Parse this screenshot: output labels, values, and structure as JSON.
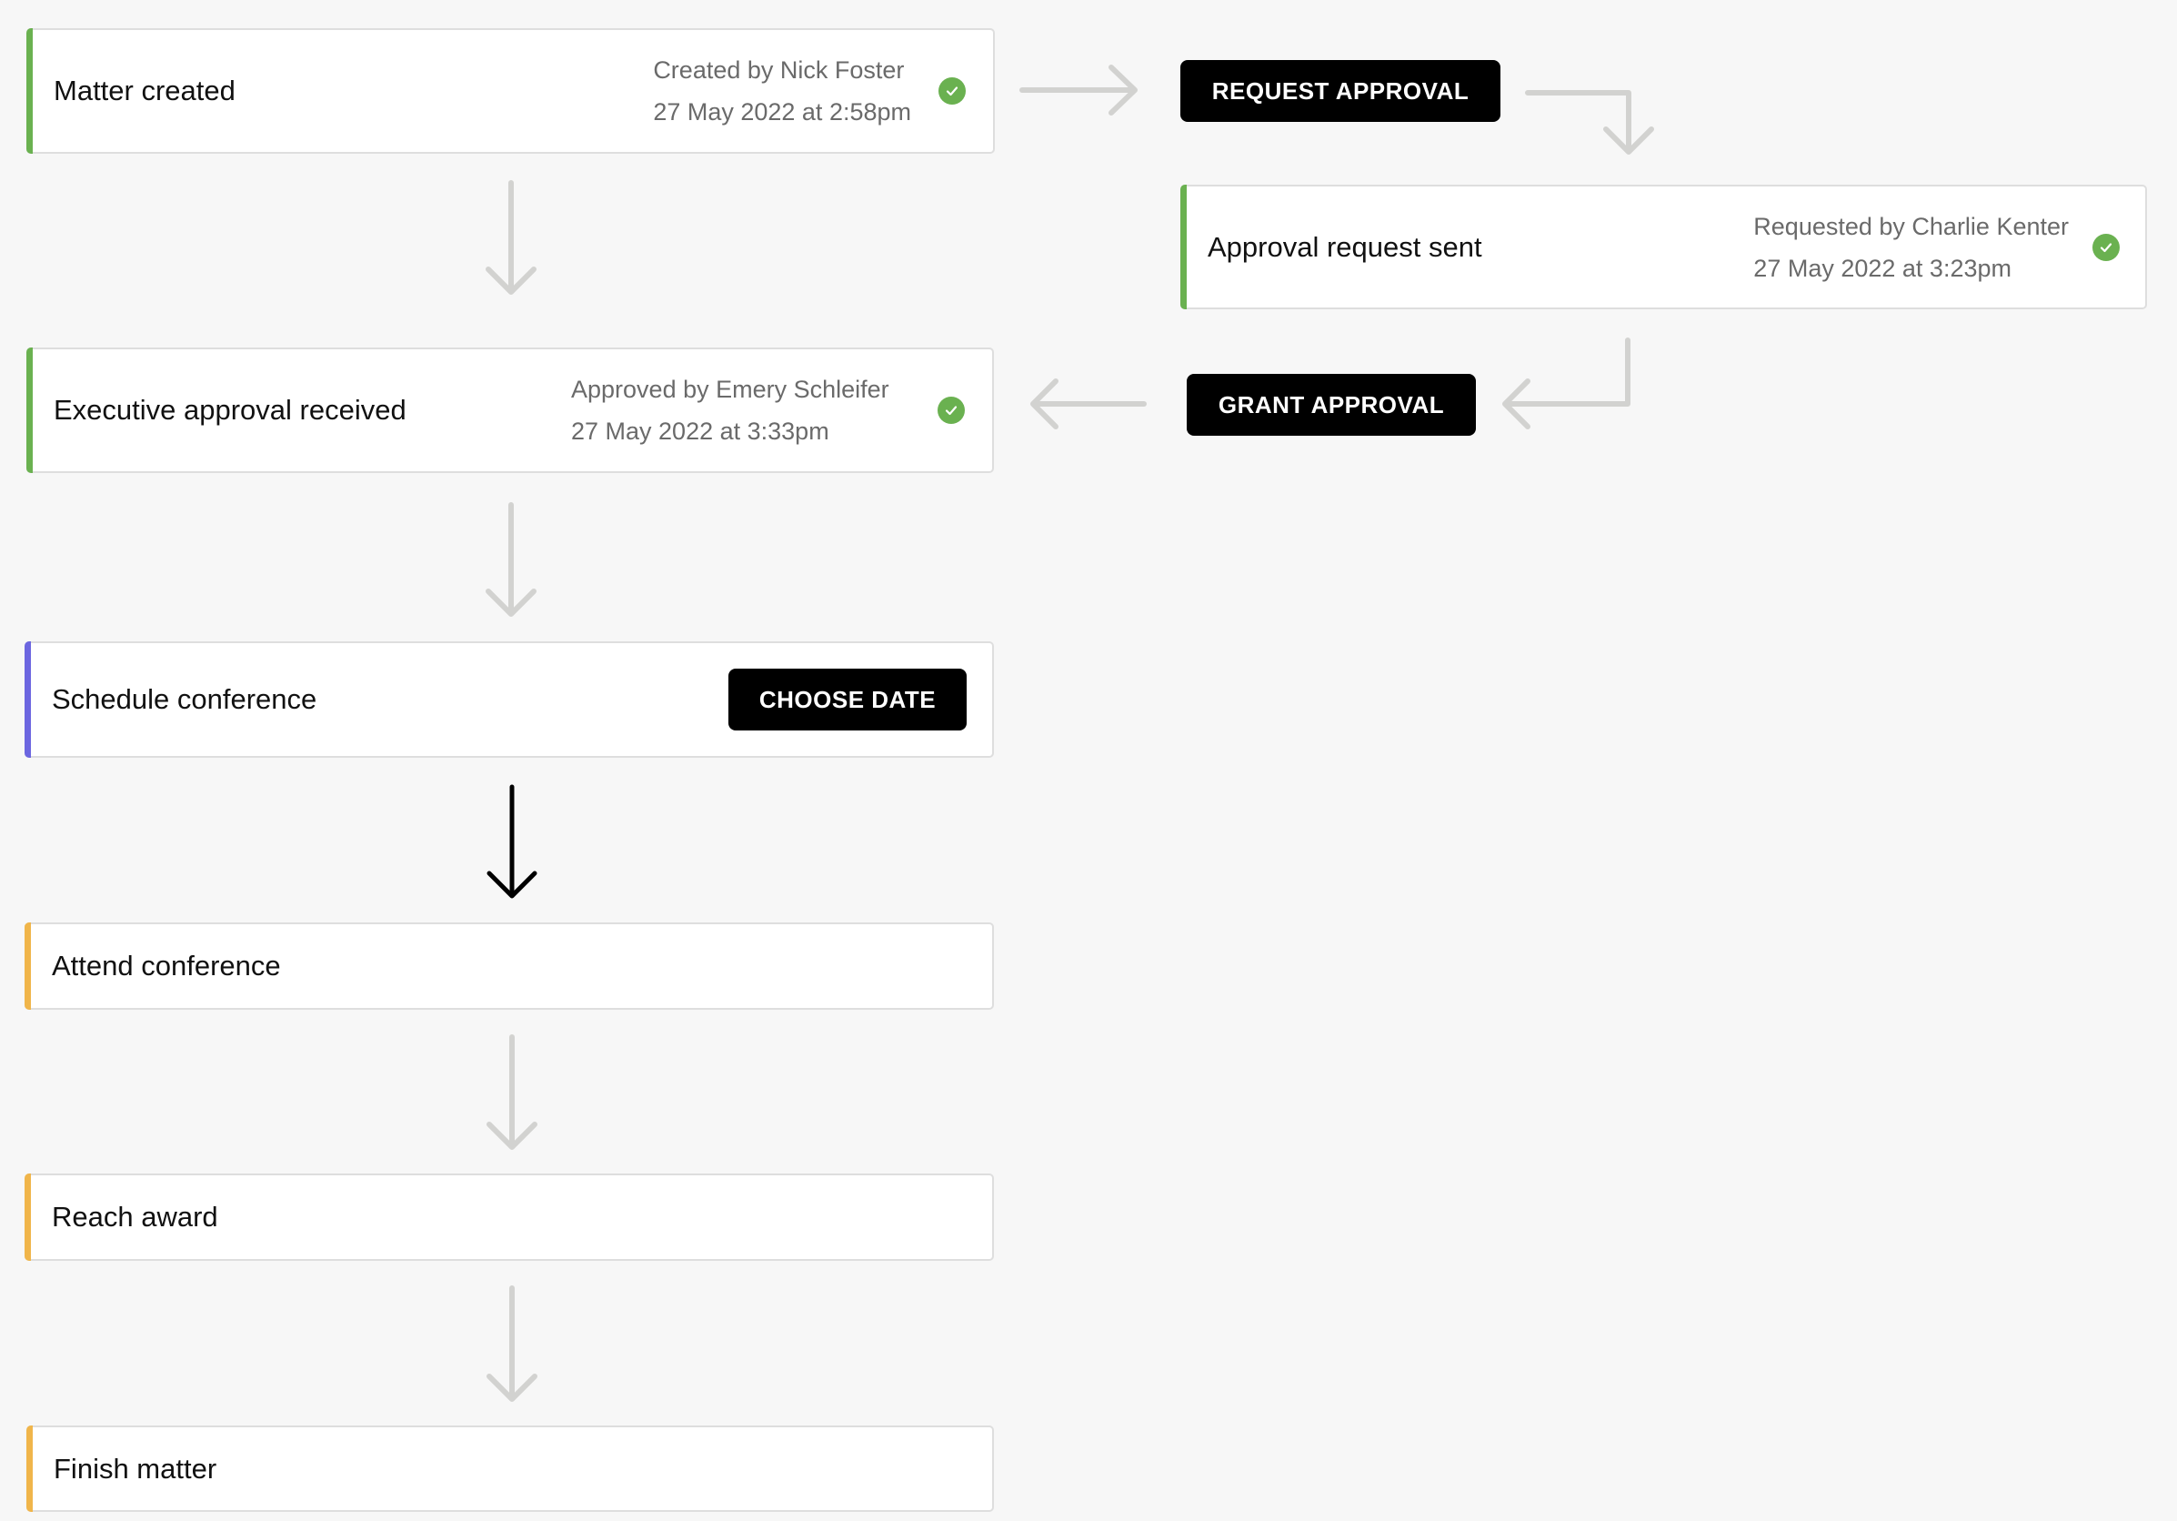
{
  "colors": {
    "background": "#f7f7f7",
    "done": "#6ab150",
    "active": "#6c66e0",
    "pending": "#f0b54a",
    "connector_inactive": "#d2d2d0",
    "connector_active": "#000000"
  },
  "workflow": {
    "steps": [
      {
        "title": "Matter created",
        "status": "done",
        "meta_line1": "Created by Nick Foster",
        "meta_line2": "27 May 2022 at 2:58pm",
        "icon": "check-circle-icon"
      },
      {
        "title": "Approval request sent",
        "status": "done",
        "meta_line1": "Requested by Charlie Kenter",
        "meta_line2": "27 May 2022 at 3:23pm",
        "icon": "check-circle-icon"
      },
      {
        "title": "Executive approval received",
        "status": "done",
        "meta_line1": "Approved by Emery Schleifer",
        "meta_line2": "27 May 2022 at 3:33pm",
        "icon": "check-circle-icon"
      },
      {
        "title": "Schedule conference",
        "status": "active",
        "action_label": "CHOOSE DATE"
      },
      {
        "title": "Attend conference",
        "status": "pending"
      },
      {
        "title": "Reach award",
        "status": "pending"
      },
      {
        "title": "Finish matter",
        "status": "pending"
      }
    ],
    "actions": {
      "request_approval": "REQUEST APPROVAL",
      "grant_approval": "GRANT APPROVAL"
    }
  }
}
